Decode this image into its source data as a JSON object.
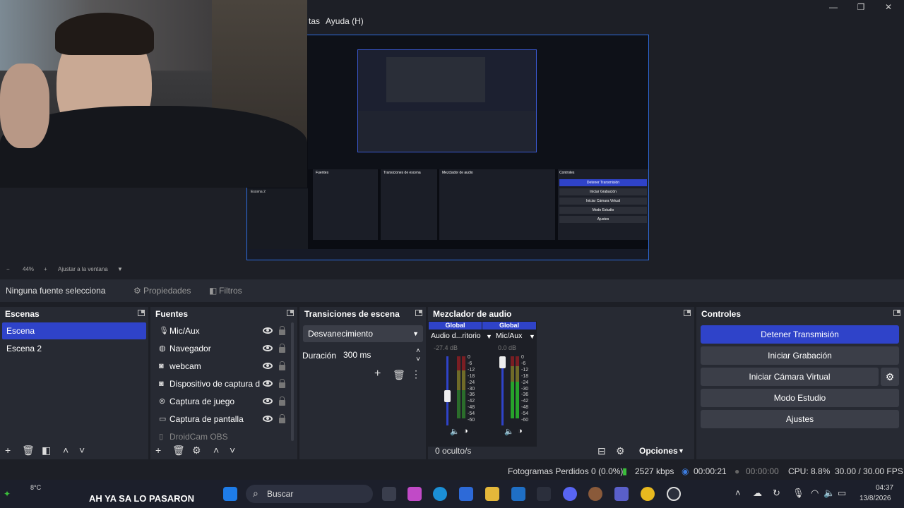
{
  "window": {
    "menu_partial": "tas",
    "menu_help": "Ayuda (H)",
    "buttons": [
      "—",
      "❐",
      "✕"
    ]
  },
  "zoombar": {
    "minus": "−",
    "zoom": "44%",
    "plus": "+",
    "fit": "Ajustar a la ventana"
  },
  "contextbar": {
    "no_source": "Ninguna fuente selecciona",
    "properties": "Propiedades",
    "filters": "Filtros"
  },
  "scenes": {
    "title": "Escenas",
    "items": [
      {
        "label": "Escena",
        "selected": true
      },
      {
        "label": "Escena 2",
        "selected": false
      }
    ]
  },
  "sources": {
    "title": "Fuentes",
    "items": [
      {
        "label": "Mic/Aux",
        "icon": "mic-icon"
      },
      {
        "label": "Navegador",
        "icon": "globe-icon"
      },
      {
        "label": "webcam",
        "icon": "camera-icon"
      },
      {
        "label": "Dispositivo de captura d",
        "icon": "camera-icon"
      },
      {
        "label": "Captura de juego",
        "icon": "gamepad-icon"
      },
      {
        "label": "Captura de pantalla",
        "icon": "monitor-icon"
      },
      {
        "label": "DroidCam OBS",
        "icon": "droidcam-icon"
      }
    ]
  },
  "transitions": {
    "title": "Transiciones de escena",
    "selected": "Desvanecimiento",
    "duration_label": "Duración",
    "duration_value": "300 ms"
  },
  "mixer": {
    "title": "Mezclador de audio",
    "channels": [
      {
        "tag": "Global",
        "name": "Audio d...ritorio",
        "db": "-27.4 dB",
        "level": 0.42
      },
      {
        "tag": "Global",
        "name": "Mic/Aux",
        "db": "0.0 dB",
        "level": 0.95
      }
    ],
    "scale": [
      "0",
      "-6",
      "-12",
      "-18",
      "-24",
      "-30",
      "-36",
      "-42",
      "-48",
      "-54",
      "-60"
    ],
    "hidden": "0 oculto/s",
    "options": "Opciones"
  },
  "controls": {
    "title": "Controles",
    "buttons": [
      "Detener Transmisión",
      "Iniciar Grabación",
      "Iniciar Cámara Virtual",
      "Modo Estudio",
      "Ajustes"
    ]
  },
  "status": {
    "dropped": "Fotogramas Perdidos 0 (0.0%)",
    "kbps": "2527 kbps",
    "stream_time": "00:00:21",
    "rec_time": "00:00:00",
    "cpu": "CPU: 8.8%",
    "fps": "30.00 / 30.00 FPS"
  },
  "taskbar": {
    "temp": "8°C",
    "news": "AH YA SA LO PASARON",
    "search": "Buscar",
    "time": "04:37",
    "date": "13/8/2026"
  },
  "nested": {
    "scene2": "Escena 2",
    "dock_titles": [
      "Fuentes",
      "Transiciones de escena",
      "Mezclador de audio",
      "Controles"
    ],
    "controls": [
      "Detener Transmisión",
      "Iniciar Grabación",
      "Iniciar Cámara Virtual",
      "Modo Estudio",
      "Ajustes"
    ]
  },
  "colors": {
    "accent": "#2f43c9",
    "bg": "#1d1f26",
    "dock": "#272a33",
    "button": "#3b3e48"
  }
}
